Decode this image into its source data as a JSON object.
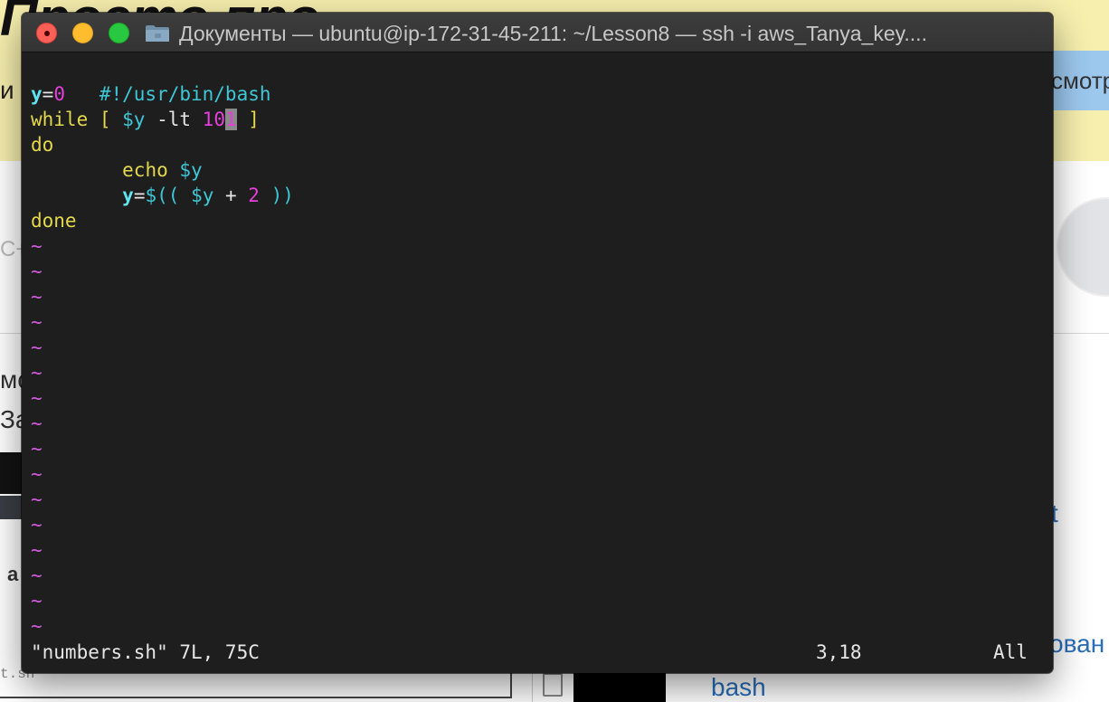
{
  "background": {
    "heading": "Просто про",
    "left_letter": "и",
    "right_button_text": "смотр",
    "cplus": "С+",
    "left_big_lines": [
      "мо",
      "За"
    ],
    "left_a": "a",
    "file_label": "t.sh",
    "link_bash": "bash",
    "right_t": "t",
    "right_ovan": "ован"
  },
  "window": {
    "title": "Документы — ubuntu@ip-172-31-45-211: ~/Lesson8 — ssh -i aws_Tanya_key...."
  },
  "editor": {
    "lines": {
      "l1": "#!/usr/bin/bash",
      "l2_var": "y",
      "l2_eq": "=",
      "l2_val": "0",
      "l3_kw": "while",
      "l3_open": " [ ",
      "l3_var": "$y",
      "l3_op": " -lt ",
      "l3_num_a": "10",
      "l3_num_b": "1",
      "l3_close": " ]",
      "l4": "do",
      "l5_indent": "        ",
      "l5_cmd": "echo",
      "l5_sp": " ",
      "l5_var": "$y",
      "l6_indent": "        ",
      "l6_var": "y",
      "l6_eq": "=",
      "l6_open": "$((",
      "l6_sp": " ",
      "l6_var2": "$y",
      "l6_plus": " + ",
      "l6_num": "2",
      "l6_close": " ))",
      "l7": "done"
    },
    "tilde": "~",
    "status_file": "\"numbers.sh\" 7L, 75C",
    "status_pos": "3,18",
    "status_scroll": "All"
  },
  "colors": {
    "terminal_bg": "#1e1e1e",
    "keyword_yellow": "#e3d94b",
    "variable_cyan": "#3ec7d6",
    "number_magenta": "#e63fdb",
    "tilde_magenta": "#d05cd8"
  }
}
